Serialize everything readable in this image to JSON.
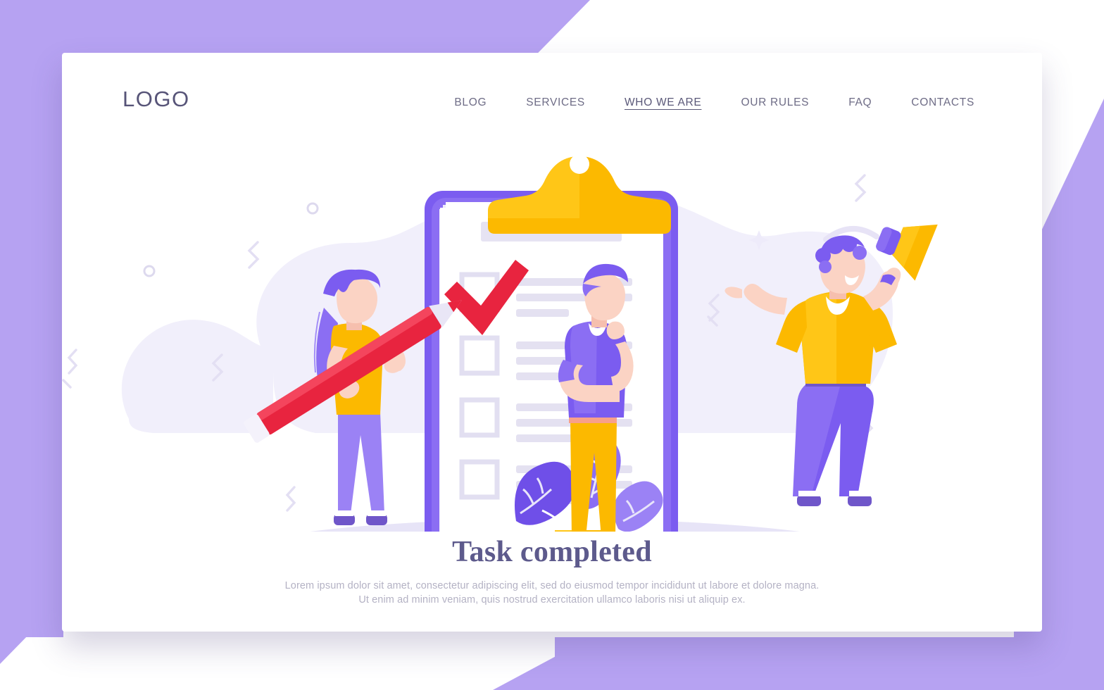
{
  "page": {
    "background_color": "#b6a2f2",
    "card_color": "#ffffff"
  },
  "header": {
    "logo": "LOGO",
    "nav": [
      {
        "label": "BLOG",
        "active": false
      },
      {
        "label": "SERVICES",
        "active": false
      },
      {
        "label": "WHO WE ARE",
        "active": true
      },
      {
        "label": "OUR RULES",
        "active": false
      },
      {
        "label": "FAQ",
        "active": false
      },
      {
        "label": "CONTACTS",
        "active": false
      }
    ]
  },
  "caption": {
    "headline": "Task completed",
    "subtitle_line1": "Lorem ipsum dolor sit amet, consectetur adipiscing elit, sed do eiusmod tempor incididunt ut labore et dolore magna.",
    "subtitle_line2": "Ut enim ad minim veniam, quis nostrud exercitation ullamco laboris nisi ut aliquip ex."
  },
  "illustration": {
    "name": "task-completed-illustration",
    "colors": {
      "purple": "#7b5cf0",
      "purple_light": "#9b82f5",
      "lavender": "#e9e7f7",
      "lavender_pale": "#f2f0fb",
      "yellow": "#fcb900",
      "yellow_deep": "#f5a623",
      "red": "#e8243f",
      "skin": "#fbd3c4",
      "skin_shadow": "#f6bfae",
      "paper": "#ffffff",
      "line_gray": "#e4e2ef"
    },
    "elements": [
      {
        "name": "background-blob",
        "type": "blob"
      },
      {
        "name": "ground-ellipse",
        "type": "ellipse"
      },
      {
        "name": "clipboard",
        "type": "clipboard",
        "clip_color": "#fcb900",
        "board_color": "#7b5cf0"
      },
      {
        "name": "checklist",
        "checkbox_count": 4,
        "checked_index": 0,
        "lines_per_row": 3
      },
      {
        "name": "checkmark",
        "color": "#e8243f"
      },
      {
        "name": "character-woman-with-pencil",
        "hair": "#7b5cf0",
        "top": "#fcb900",
        "pants": "#9b82f5"
      },
      {
        "name": "pencil",
        "body": "#e8243f",
        "tip": "#e9e7f7"
      },
      {
        "name": "character-man-thinking",
        "hair": "#7b5cf0",
        "top": "#7b5cf0",
        "pants": "#fcb900"
      },
      {
        "name": "character-man-celebrating",
        "hair": "#7b5cf0",
        "top": "#fcb900",
        "pants": "#7b5cf0"
      },
      {
        "name": "megaphone",
        "color": "#fcb900",
        "grip": "#7b5cf0"
      },
      {
        "name": "potted-plant",
        "leaves": "#7b5cf0",
        "pot": "#fcb900"
      },
      {
        "name": "decor-squiggles",
        "count": 6
      },
      {
        "name": "decor-circles",
        "count": 5
      },
      {
        "name": "decor-sparkles",
        "count": 3
      }
    ]
  }
}
